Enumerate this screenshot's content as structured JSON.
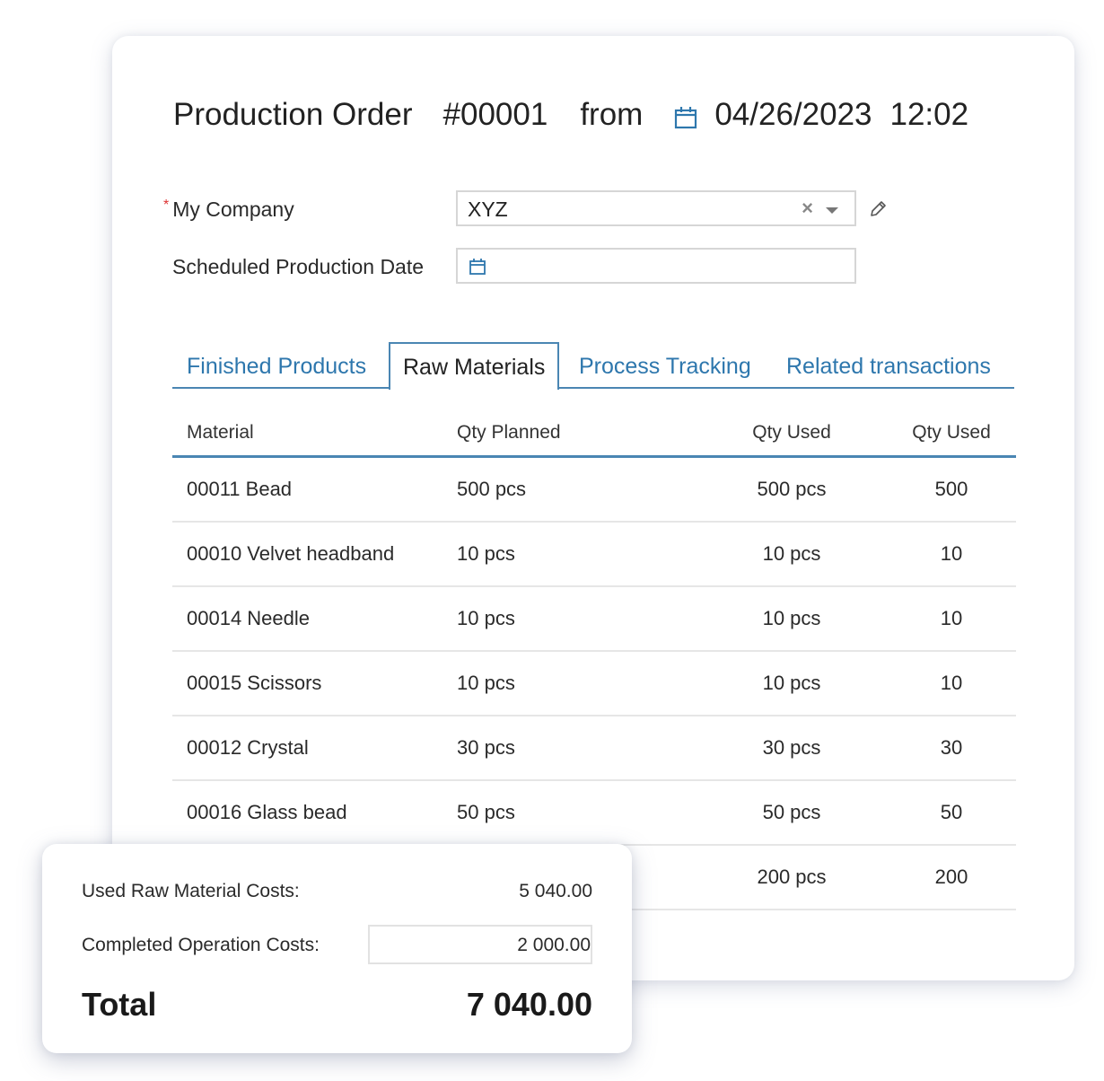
{
  "header": {
    "doc_type": "Production Order",
    "number": "#00001",
    "from_label": "from",
    "date": "04/26/2023",
    "time": "12:02"
  },
  "form": {
    "company": {
      "label": "My Company",
      "required_mark": "*",
      "value": "XYZ",
      "clear_glyph": "×"
    },
    "scheduled_date": {
      "label": "Scheduled Production Date",
      "value": ""
    }
  },
  "tabs": [
    {
      "label": "Finished Products",
      "active": false
    },
    {
      "label": "Raw Materials",
      "active": true
    },
    {
      "label": "Process Tracking",
      "active": false
    },
    {
      "label": "Related transactions",
      "active": false
    }
  ],
  "table": {
    "columns": [
      "Material",
      "Qty Planned",
      "Qty Used",
      "Qty Used"
    ],
    "rows": [
      [
        "00011 Bead",
        "500 pcs",
        "500 pcs",
        "500"
      ],
      [
        "00010 Velvet headband",
        "10 pcs",
        "10 pcs",
        "10"
      ],
      [
        "00014 Needle",
        "10 pcs",
        "10 pcs",
        "10"
      ],
      [
        "00015 Scissors",
        "10 pcs",
        "10 pcs",
        "10"
      ],
      [
        "00012 Crystal",
        "30 pcs",
        "30 pcs",
        "30"
      ],
      [
        "00016 Glass bead",
        "50 pcs",
        "50 pcs",
        "50"
      ],
      [
        "",
        "",
        "200 pcs",
        "200"
      ]
    ]
  },
  "summary": {
    "raw_material_label": "Used Raw Material Costs:",
    "raw_material_value": "5 040.00",
    "operation_label": "Completed Operation Costs:",
    "operation_value": "2 000.00",
    "total_label": "Total",
    "total_value": "7 040.00"
  },
  "colors": {
    "accent": "#2e77ad",
    "tab_border": "#4a86b3",
    "required": "#dd3333"
  }
}
